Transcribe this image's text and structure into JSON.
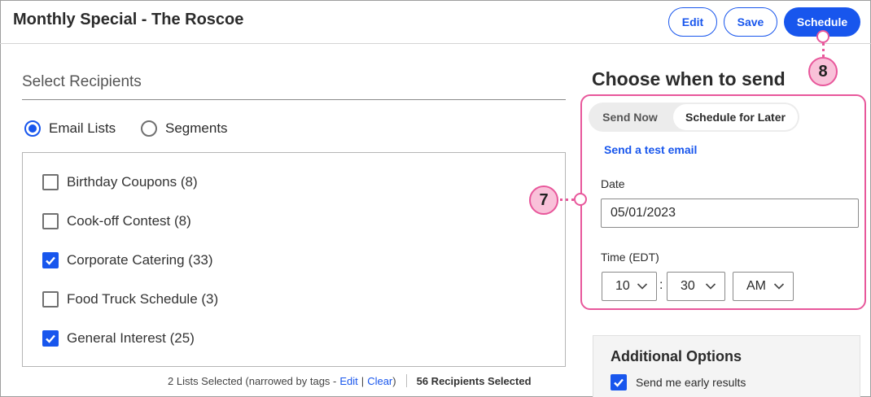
{
  "header": {
    "title": "Monthly Special - The Roscoe",
    "edit_label": "Edit",
    "save_label": "Save",
    "schedule_label": "Schedule"
  },
  "recipients": {
    "section_title": "Select Recipients",
    "radio_options": [
      {
        "label": "Email Lists",
        "selected": true
      },
      {
        "label": "Segments",
        "selected": false
      }
    ],
    "lists": [
      {
        "label": "Birthday Coupons (8)",
        "checked": false
      },
      {
        "label": "Cook-off Contest (8)",
        "checked": false
      },
      {
        "label": "Corporate Catering (33)",
        "checked": true
      },
      {
        "label": "Food Truck Schedule (3)",
        "checked": false
      },
      {
        "label": "General Interest (25)",
        "checked": true
      }
    ],
    "footer": {
      "lists_selected": "2 Lists Selected (narrowed by tags -",
      "edit_link": "Edit",
      "divider": "|",
      "clear_link": "Clear",
      "close_paren": ")",
      "recipients_selected": "56 Recipients Selected"
    }
  },
  "send": {
    "title": "Choose when to send",
    "tabs": [
      "Send Now",
      "Schedule for Later"
    ],
    "active_tab": "Schedule for Later",
    "test_email_link": "Send a test email",
    "date_label": "Date",
    "date_value": "05/01/2023",
    "time_label": "Time (EDT)",
    "hour": "10",
    "colon": ":",
    "minute": "30",
    "ampm": "AM"
  },
  "additional": {
    "title": "Additional Options",
    "early_results_label": "Send me early results",
    "early_results_checked": true
  },
  "callouts": {
    "seven": "7",
    "eight": "8"
  },
  "colors": {
    "accent": "#1856ed",
    "callout_border": "#e8579b",
    "callout_fill": "#f9c1d9"
  }
}
